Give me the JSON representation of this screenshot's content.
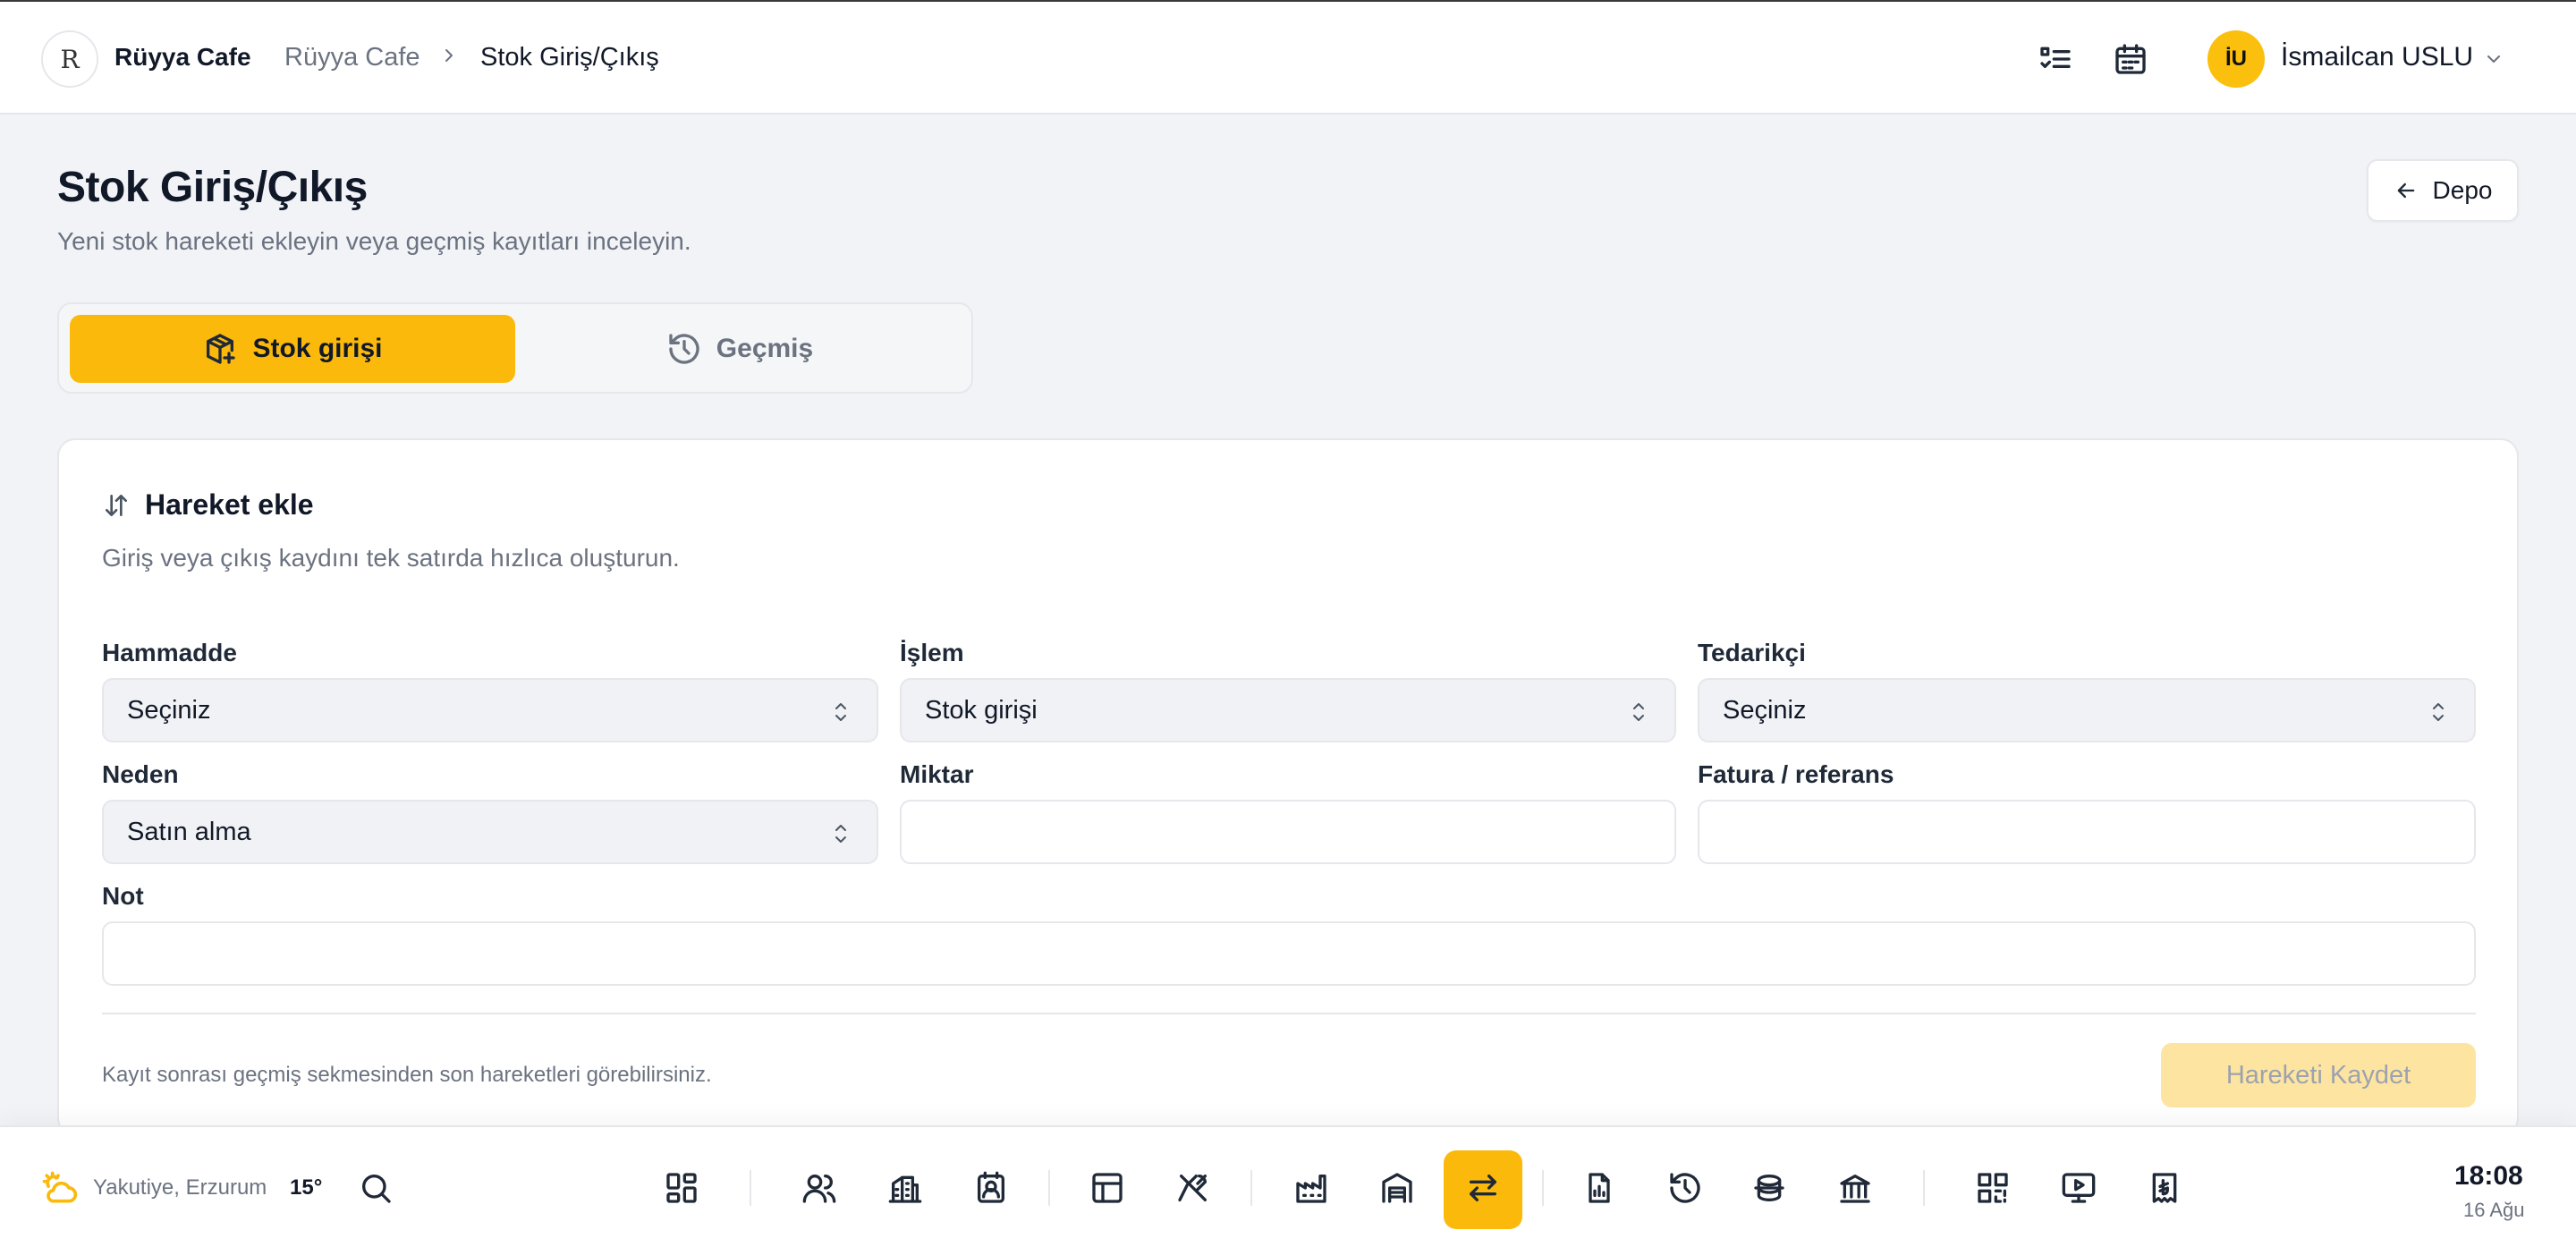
{
  "app": {
    "brand": "Rüyya Cafe",
    "logo_text": "R"
  },
  "breadcrumb": {
    "items": [
      "Rüyya Cafe",
      "Stok Giriş/Çıkış"
    ]
  },
  "user": {
    "initials": "İU",
    "name": "İsmailcan USLU"
  },
  "header": {
    "title": "Stok Giriş/Çıkış",
    "subtitle": "Yeni stok hareketi ekleyin veya geçmiş kayıtları inceleyin.",
    "back_button": "Depo"
  },
  "tabs": [
    {
      "label": "Stok girişi",
      "icon": "package-plus-icon",
      "active": true
    },
    {
      "label": "Geçmiş",
      "icon": "history-icon",
      "active": false
    }
  ],
  "form": {
    "title": "Hareket ekle",
    "subtitle": "Giriş veya çıkış kaydını tek satırda hızlıca oluşturun.",
    "fields": {
      "hammadde": {
        "label": "Hammadde",
        "value": "Seçiniz"
      },
      "islem": {
        "label": "İşlem",
        "value": "Stok girişi"
      },
      "tedarikci": {
        "label": "Tedarikçi",
        "value": "Seçiniz"
      },
      "neden": {
        "label": "Neden",
        "value": "Satın alma"
      },
      "miktar": {
        "label": "Miktar",
        "value": ""
      },
      "fatura": {
        "label": "Fatura / referans",
        "value": ""
      },
      "not": {
        "label": "Not",
        "value": ""
      }
    },
    "footnote": "Kayıt sonrası geçmiş sekmesinden son hareketleri görebilirsiniz.",
    "save_button": "Hareketi Kaydet"
  },
  "bottombar": {
    "location": "Yakutiye, Erzurum",
    "temperature": "15°",
    "time": "18:08",
    "date": "16 Ağu"
  },
  "colors": {
    "accent": "#fbb90b",
    "accent_disabled": "#fde4a0",
    "text": "#111827",
    "muted": "#6b7280"
  }
}
